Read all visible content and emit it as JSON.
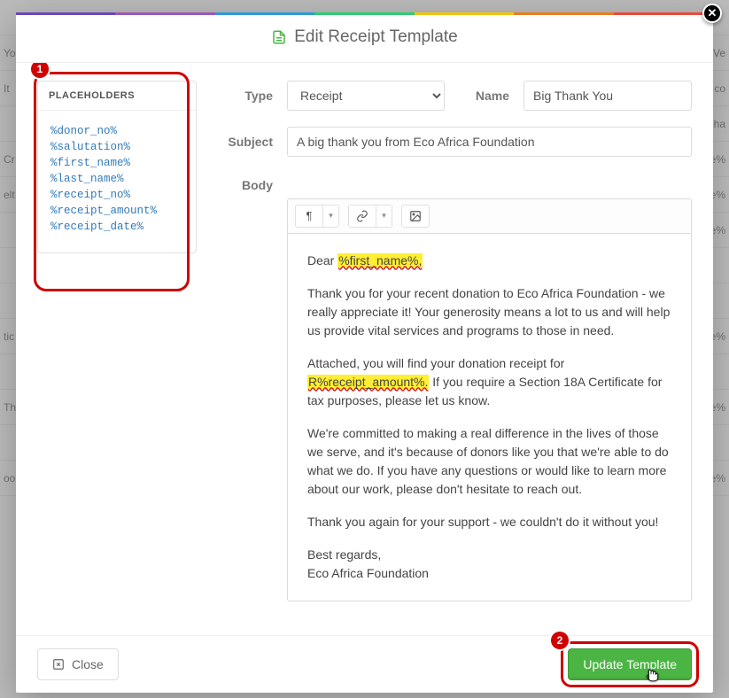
{
  "bg_rows": [
    {
      "left": "",
      "right": ""
    },
    {
      "left": "Yo",
      "right": "Ve"
    },
    {
      "left": "It",
      "right": "co"
    },
    {
      "left": "",
      "right": "ha"
    },
    {
      "left": "Cr",
      "right": "e%"
    },
    {
      "left": "elt",
      "right": "e%"
    },
    {
      "left": "",
      "right": "e%"
    },
    {
      "left": "",
      "right": ""
    },
    {
      "left": "",
      "right": ""
    },
    {
      "left": "tic",
      "right": "e%"
    },
    {
      "left": "",
      "right": ""
    },
    {
      "left": "Th",
      "right": "e%"
    },
    {
      "left": "",
      "right": ""
    },
    {
      "left": "oo",
      "right": "e%"
    }
  ],
  "modal": {
    "title": "Edit Receipt Template"
  },
  "placeholders": {
    "heading": "PLACEHOLDERS",
    "items": [
      "%donor_no%",
      "%salutation%",
      "%first_name%",
      "%last_name%",
      "%receipt_no%",
      "%receipt_amount%",
      "%receipt_date%"
    ]
  },
  "form": {
    "type_label": "Type",
    "type_value": "Receipt",
    "name_label": "Name",
    "name_value": "Big Thank You",
    "subject_label": "Subject",
    "subject_value": "A big thank you from Eco Africa Foundation",
    "body_label": "Body"
  },
  "toolbar": {
    "paragraph": "¶",
    "caret": "▾"
  },
  "body_content": {
    "greeting_pre": "Dear ",
    "greeting_hl": "%first_name%,",
    "p1": "Thank you for your recent donation to Eco Africa Foundation - we really appreciate it! Your generosity means a lot to us and will help us provide vital services and programs to those in need.",
    "p2_pre": "Attached, you will find your donation receipt for ",
    "p2_hl": "R%receipt_amount%.",
    "p2_post": " If you require a Section 18A Certificate for tax purposes, please let us know.",
    "p3": "We're committed to making a real difference in the lives of those we serve, and it's because of donors like you that we're able to do what we do. If you have any questions or would like to learn more about our work, please don't hesitate to reach out.",
    "p4": "Thank you again for your support - we couldn't do it without you!",
    "signoff1": "Best regards,",
    "signoff2": "Eco Africa Foundation"
  },
  "footer": {
    "close": "Close",
    "submit": "Update Template"
  },
  "annotations": {
    "badge1": "1",
    "badge2": "2"
  }
}
